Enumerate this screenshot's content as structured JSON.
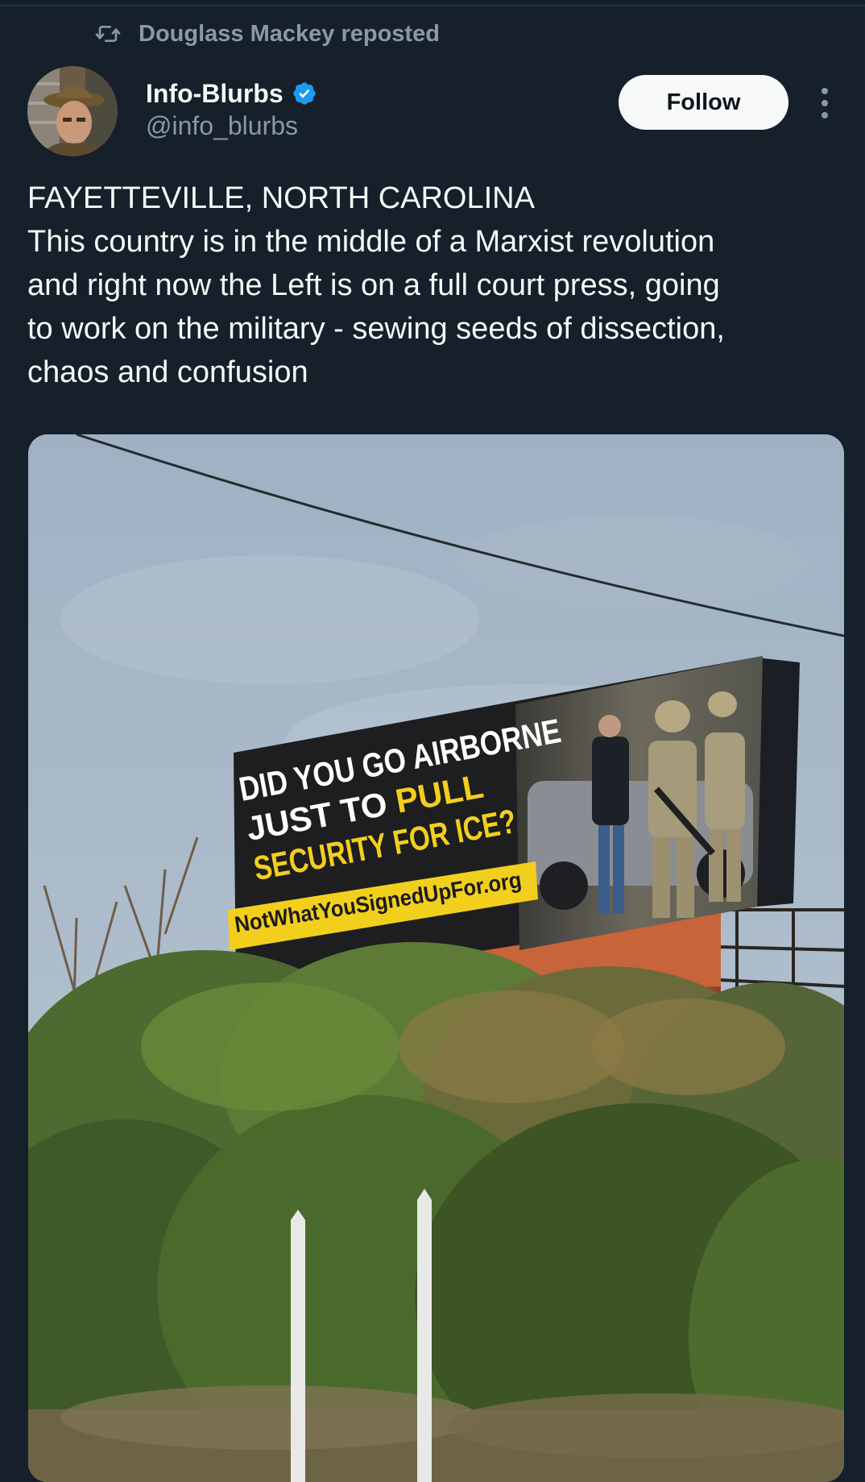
{
  "repost": {
    "icon": "repost-icon",
    "text": "Douglass Mackey reposted"
  },
  "author": {
    "avatar": "avatar",
    "name": "Info-Blurbs",
    "verified_icon": "verified-badge-icon",
    "handle": "@info_blurbs"
  },
  "actions": {
    "follow_label": "Follow",
    "more_icon": "more-options-icon"
  },
  "post": {
    "lines": [
      "FAYETTEVILLE, NORTH CAROLINA",
      "This country is in the middle of a Marxist revolution",
      "and right now the Left is on a full court press, going",
      "to work on the military - sewing seeds of dissection,",
      "chaos and confusion"
    ]
  },
  "media": {
    "billboard": {
      "line1": "DID YOU GO AIRBORNE",
      "line2_prefix": "JUST TO ",
      "line2_highlight": "PULL",
      "line3": "SECURITY FOR ICE?",
      "url": "NotWhatYouSignedUpFor.org"
    }
  },
  "colors": {
    "background": "#15202b",
    "text_primary": "#f7f9f9",
    "text_secondary": "#8b98a5",
    "verified_blue": "#1d9bf0",
    "billboard_yellow": "#f3cf1d",
    "billboard_orange": "#c8643a"
  }
}
